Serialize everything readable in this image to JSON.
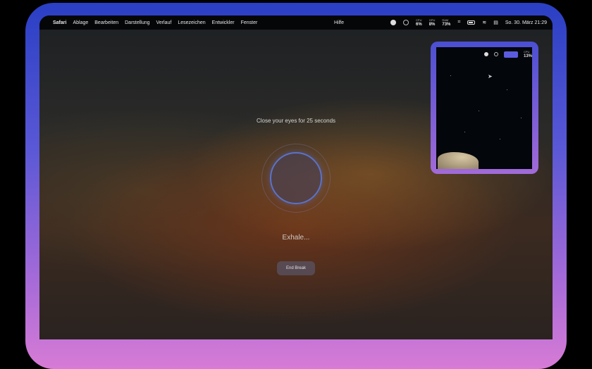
{
  "menubar": {
    "app": "Safari",
    "items": [
      "Ablage",
      "Bearbeiten",
      "Darstellung",
      "Verlauf",
      "Lesezeichen",
      "Entwickler",
      "Fenster"
    ],
    "help": "Hilfe",
    "stats": [
      {
        "label": "CPU",
        "value": "6%"
      },
      {
        "label": "GPU",
        "value": "8%"
      },
      {
        "label": "RAM",
        "value": "73%"
      }
    ],
    "clock": "So. 30. März  21:29"
  },
  "break": {
    "prompt": "Close your eyes for 25 seconds",
    "phase": "Exhale...",
    "end_label": "End Break"
  },
  "thumbnail": {
    "cpu_label": "CPU",
    "cpu_value": "13%"
  },
  "colors": {
    "accent": "#5b72c8",
    "frame_top": "#2a3fc4",
    "frame_bottom": "#d77bd6"
  }
}
